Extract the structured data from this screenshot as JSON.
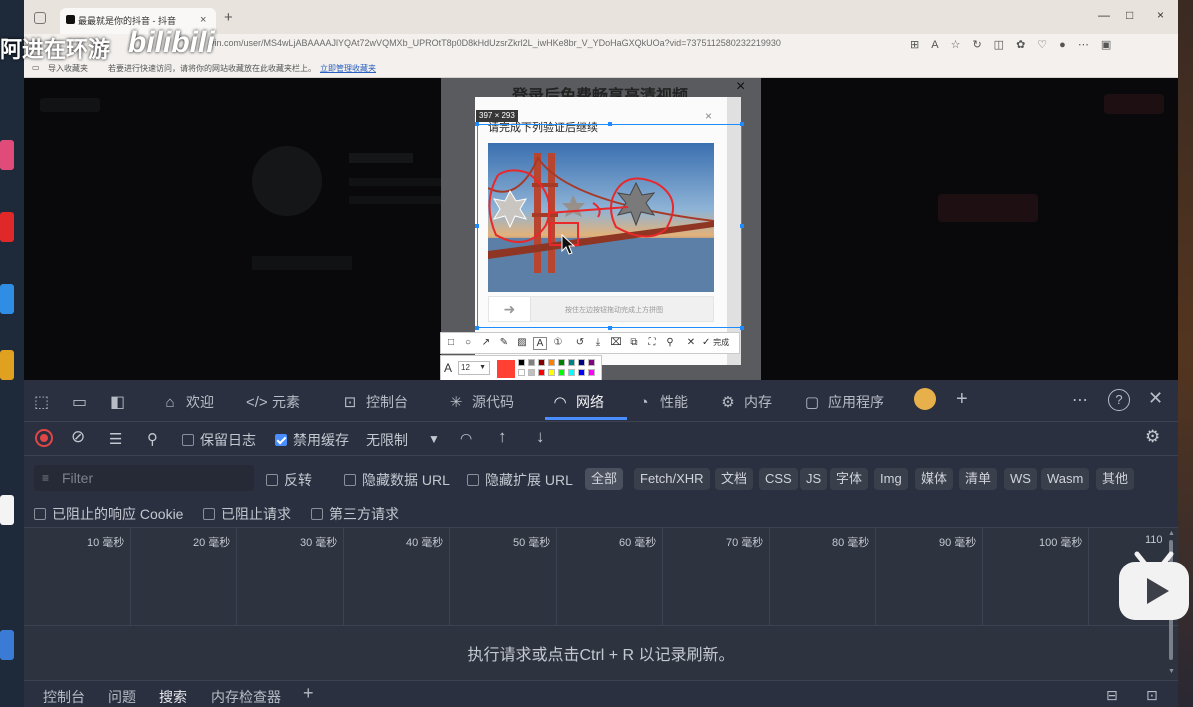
{
  "overlay": {
    "uploader_name": "阿进在环游",
    "platform_logo": "bilibili",
    "platform_icon": "bilibili-tv-icon"
  },
  "browser": {
    "tab_title": "最最就是你的抖音 - 抖音",
    "new_tab": "+",
    "tab_close": "×",
    "url": "vin.com/user/MS4wLjABAAAAJlYQAt72wVQMXb_UPROtT8p0D8kHdUzsrZkrl2L_iwHKe8br_V_YDoHaGXQkUOa?vid=7375112580232219930",
    "bookmarks": {
      "import": "导入收藏夹",
      "hint": "若要进行快速访问，请将你的网站收藏放在此收藏夹栏上。",
      "manage_link": "立即管理收藏夹"
    },
    "window_controls": [
      "—",
      "□",
      "×"
    ]
  },
  "page": {
    "modal_title": "登录后免费畅享高清视频",
    "modal_close": "×"
  },
  "captcha": {
    "title": "请完成下列验证后继续",
    "close": "×",
    "slider_arrow": "➜",
    "slider_hint": "按住左边按钮拖动完成上方拼图"
  },
  "snip": {
    "size_label": "397 × 293",
    "done_label": "完成",
    "font_letter": "A",
    "font_size": "12",
    "current_color": "#ff4033",
    "palette": [
      "#000000",
      "#808080",
      "#800000",
      "#ff8000",
      "#008000",
      "#008080",
      "#000080",
      "#800080",
      "#ffffff",
      "#c0c0c0",
      "#ff0000",
      "#ffff00",
      "#00ff00",
      "#00ffff",
      "#0000ff",
      "#ff00ff"
    ]
  },
  "devtools": {
    "tabs": [
      {
        "label": "欢迎",
        "icon": "home-icon"
      },
      {
        "label": "元素",
        "icon": "code-icon"
      },
      {
        "label": "控制台",
        "icon": "console-icon"
      },
      {
        "label": "源代码",
        "icon": "bug-icon"
      },
      {
        "label": "网络",
        "icon": "wifi-icon"
      },
      {
        "label": "性能",
        "icon": "gauge-icon"
      },
      {
        "label": "内存",
        "icon": "memory-icon"
      },
      {
        "label": "应用程序",
        "icon": "app-icon"
      }
    ],
    "toolbar": {
      "preserve_log": "保留日志",
      "disable_cache": "禁用缓存",
      "throttle": "无限制"
    },
    "filter": {
      "placeholder": "Filter",
      "invert": "反转",
      "hide_data_url": "隐藏数据 URL",
      "hide_ext_url": "隐藏扩展 URL",
      "types": [
        "全部",
        "Fetch/XHR",
        "文档",
        "CSS",
        "JS",
        "字体",
        "Img",
        "媒体",
        "清单",
        "WS",
        "Wasm",
        "其他"
      ]
    },
    "blocked": {
      "blocked_cookies": "已阻止的响应 Cookie",
      "blocked_requests": "已阻止请求",
      "third_party": "第三方请求"
    },
    "timeline_ticks": [
      "10 毫秒",
      "20 毫秒",
      "30 毫秒",
      "40 毫秒",
      "50 毫秒",
      "60 毫秒",
      "70 毫秒",
      "80 毫秒",
      "90 毫秒",
      "100 毫秒",
      "110"
    ],
    "empty_message": "执行请求或点击Ctrl + R 以记录刷新。",
    "drawer_tabs": [
      "控制台",
      "问题",
      "搜索",
      "内存检查器"
    ]
  }
}
